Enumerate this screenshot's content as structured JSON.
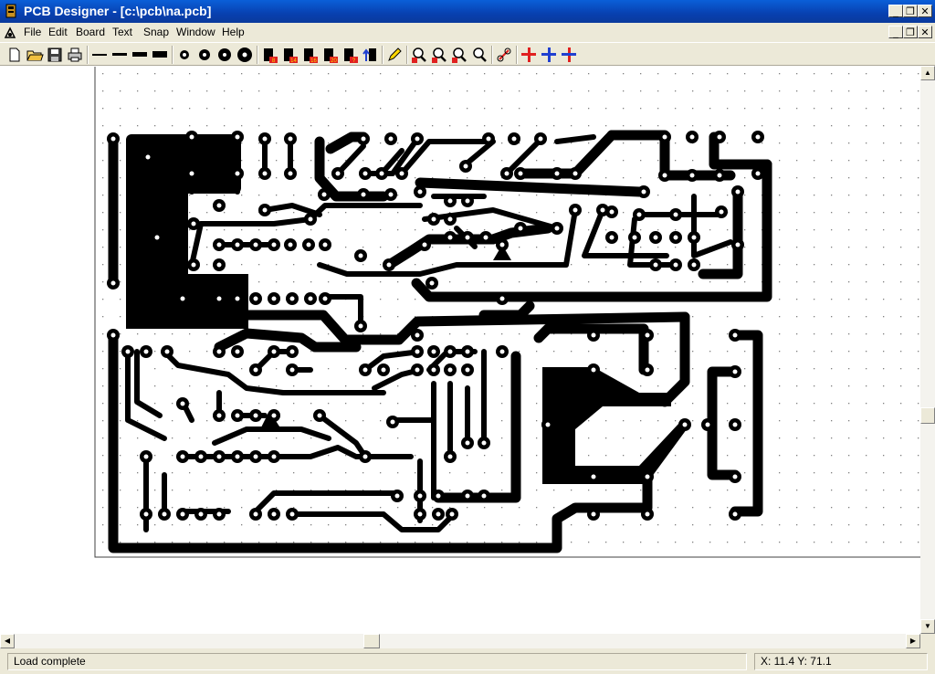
{
  "window": {
    "title": "PCB Designer - [c:\\pcb\\na.pcb]"
  },
  "menu": [
    "File",
    "Edit",
    "Board",
    "Text",
    "Snap",
    "Window",
    "Help"
  ],
  "toolbar": {
    "groups": [
      "file",
      "track-widths",
      "pad-sizes",
      "ic-packages",
      "tools",
      "zoom",
      "layers"
    ],
    "ic_labels": [
      "8",
      "14",
      "16",
      "20",
      "?"
    ],
    "colors": {
      "red": "#e02020",
      "blue": "#2040d0",
      "yellow": "#ffd800"
    }
  },
  "status": {
    "message": "Load complete",
    "coords": "X: 11.4  Y: 71.1"
  },
  "colors": {
    "titlebar": "#0a49c8",
    "copper": "#000000",
    "grid": "#808080"
  }
}
